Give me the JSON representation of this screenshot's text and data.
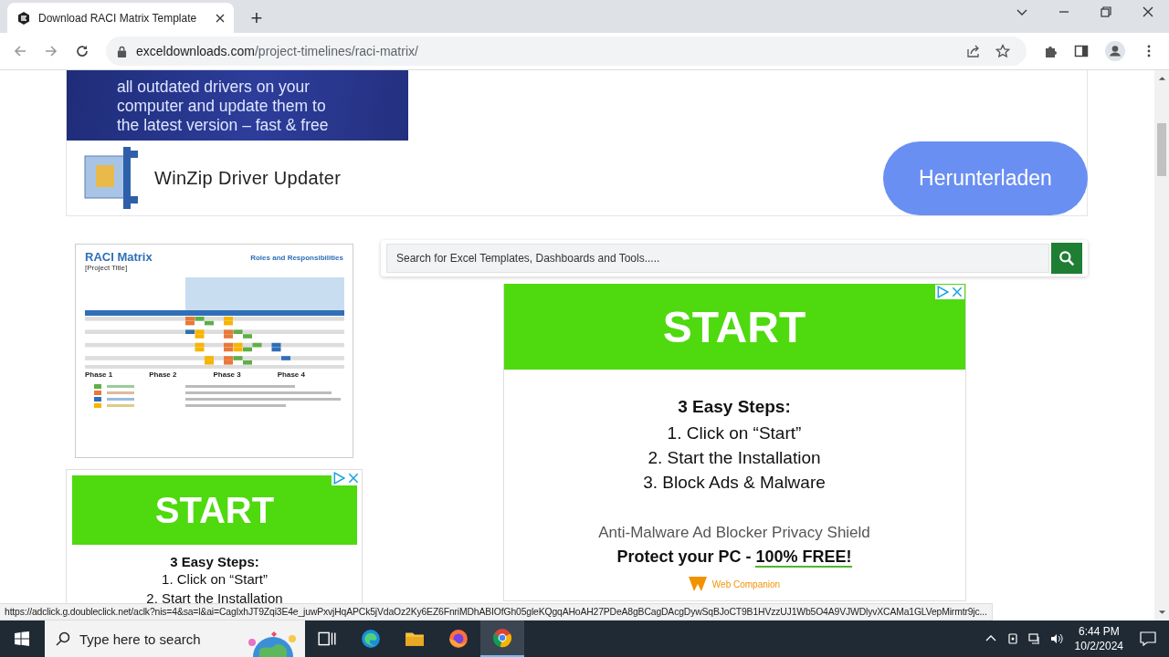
{
  "browser": {
    "tabs": [
      {
        "title": "Download RACI Matrix Template",
        "selected": true
      }
    ],
    "new_tab": "+",
    "url": {
      "domain": "exceldownloads.com",
      "path": "/project-timelines/raci-matrix/"
    }
  },
  "driver_ad": {
    "lines": [
      "all outdated drivers on your",
      "computer and update them to",
      "the latest version – fast & free"
    ],
    "product": "WinZip Driver Updater",
    "button": "Herunterladen"
  },
  "thumbnail": {
    "title": "RACI Matrix",
    "subtitle": "[Project Title]",
    "heading": "Roles and Responsibilities",
    "phases": [
      "Phase 1",
      "Phase 2",
      "Phase 3",
      "Phase 4"
    ]
  },
  "search": {
    "placeholder": "Search for Excel Templates, Dashboards and Tools....."
  },
  "ads": [
    {
      "kind": "large",
      "banner": "START",
      "heading": "3 Easy Steps:",
      "steps": [
        "1. Click on “Start”",
        "2. Start the Installation",
        "3. Block Ads & Malware"
      ],
      "tagline": "Anti-Malware Ad Blocker Privacy Shield",
      "offer": "Protect your PC - ",
      "offer_highlight": "100% FREE!",
      "brand": "Web Companion"
    },
    {
      "kind": "small",
      "banner": "START",
      "heading": "3 Easy Steps:",
      "steps": [
        "1. Click on “Start”",
        "2. Start the Installation"
      ]
    }
  ],
  "status_url": "https://adclick.g.doubleclick.net/aclk?nis=4&sa=l&ai=CagIxhJT9Zqi3E4e_juwPxvjHqAPCk5jVdaOz2Ky6EZ6FnriMDhABIOfGh05gleKQgqAHoAH27PDeA8gBCagDAcgDywSqBJoCT9B1HVzzUJ1Wb5O4A9VJWDlyvXCAMa1GLVepMirmtr9jc...",
  "taskbar": {
    "search_placeholder": "Type here to search",
    "apps": [
      {
        "kind": "taskview",
        "selected": false
      },
      {
        "kind": "edge",
        "selected": false
      },
      {
        "kind": "explorer",
        "selected": false
      },
      {
        "kind": "firefox",
        "selected": false
      },
      {
        "kind": "chrome",
        "selected": true
      }
    ],
    "time": "6:44 PM",
    "date": "10/2/2024"
  }
}
